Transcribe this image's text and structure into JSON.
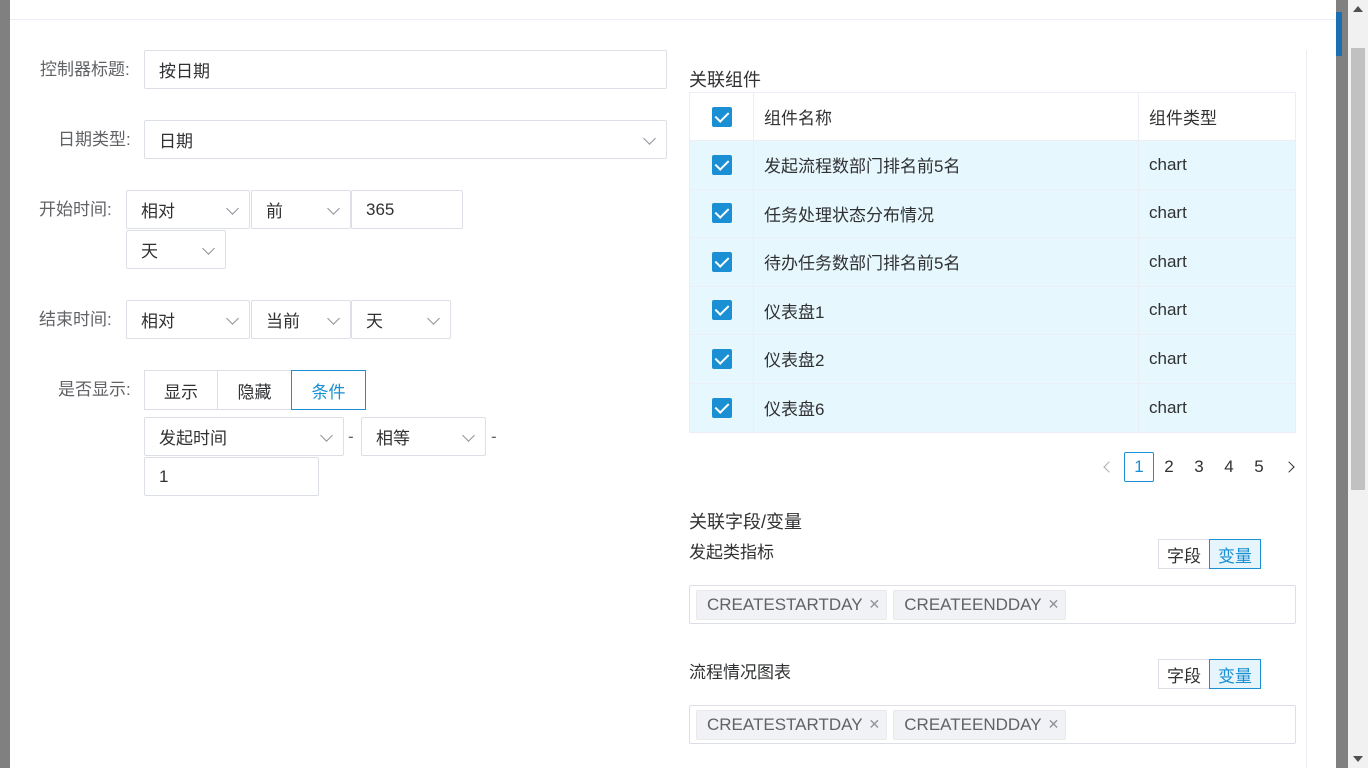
{
  "form": {
    "title_label": "控制器标题:",
    "title_value": "按日期",
    "date_type_label": "日期类型:",
    "date_type_value": "日期",
    "start_label": "开始时间:",
    "start_mode": "相对",
    "start_direction": "前",
    "start_amount": "365",
    "start_unit": "天",
    "end_label": "结束时间:",
    "end_mode": "相对",
    "end_direction": "当前",
    "end_unit": "天",
    "display_label": "是否显示:",
    "display_options": [
      "显示",
      "隐藏",
      "条件"
    ],
    "display_selected": "条件",
    "cond_field": "发起时间",
    "cond_op": "相等",
    "cond_sep": "-",
    "cond_value": "1"
  },
  "linked": {
    "title": "关联组件",
    "columns": [
      "组件名称",
      "组件类型"
    ],
    "rows": [
      {
        "name": "发起流程数部门排名前5名",
        "type": "chart"
      },
      {
        "name": "任务处理状态分布情况",
        "type": "chart"
      },
      {
        "name": "待办任务数部门排名前5名",
        "type": "chart"
      },
      {
        "name": "仪表盘1",
        "type": "chart"
      },
      {
        "name": "仪表盘2",
        "type": "chart"
      },
      {
        "name": "仪表盘6",
        "type": "chart"
      }
    ],
    "pages": [
      "1",
      "2",
      "3",
      "4",
      "5"
    ],
    "current_page": "1"
  },
  "fields": {
    "title": "关联字段/变量",
    "groups": [
      {
        "name": "发起类指标",
        "toggle": [
          "字段",
          "变量"
        ],
        "selected": "变量",
        "tags": [
          "CREATESTARTDAY",
          "CREATEENDDAY"
        ]
      },
      {
        "name": "流程情况图表",
        "toggle": [
          "字段",
          "变量"
        ],
        "selected": "变量",
        "tags": [
          "CREATESTARTDAY",
          "CREATEENDDAY"
        ]
      }
    ]
  },
  "colors": {
    "accent": "#1a8fd3",
    "row_selected": "#e6f7fd",
    "overlay": "#808080"
  }
}
